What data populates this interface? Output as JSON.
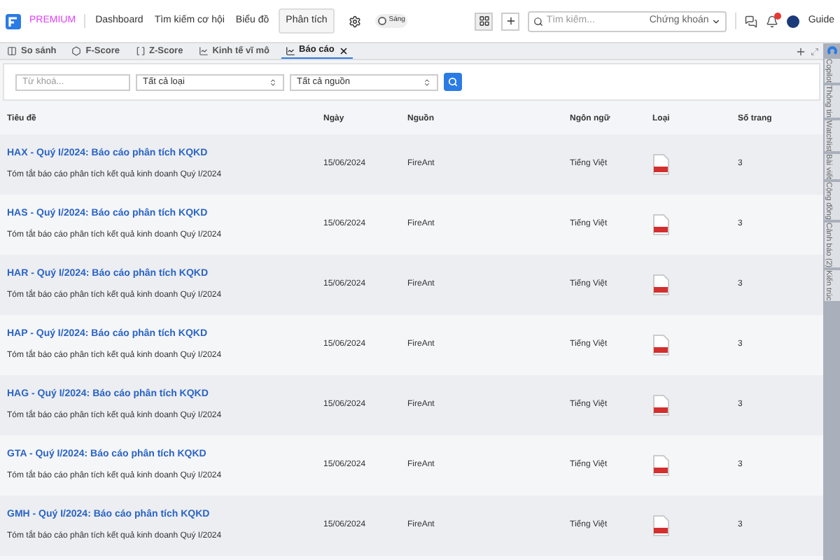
{
  "top_bar": {
    "brand": "PREMIUM",
    "nav": [
      {
        "label": "Dashboard",
        "selected": false
      },
      {
        "label": "Tìm kiếm cơ hội",
        "selected": false
      },
      {
        "label": "Biểu đồ",
        "selected": false
      },
      {
        "label": "Phân tích",
        "selected": true
      }
    ],
    "theme_toggle": {
      "label": "Sáng",
      "on": false
    },
    "search": {
      "placeholder": "Tìm kiếm...",
      "scope": "Chứng khoán"
    },
    "user": "Guide"
  },
  "tabs": [
    {
      "label": "So sánh",
      "selected": false,
      "closable": false
    },
    {
      "label": "F-Score",
      "selected": false,
      "closable": false
    },
    {
      "label": "Z-Score",
      "selected": false,
      "closable": false
    },
    {
      "label": "Kinh tế vĩ mô",
      "selected": false,
      "closable": false
    },
    {
      "label": "Báo cáo",
      "selected": true,
      "closable": true
    }
  ],
  "filters": {
    "keyword": {
      "placeholder": "Từ khoá..."
    },
    "type": "Tất cả loại",
    "source": "Tất cả nguồn"
  },
  "table": {
    "columns": [
      "Tiêu đề",
      "Ngày",
      "Nguồn",
      "Ngôn ngữ",
      "Loại",
      "Số trang"
    ],
    "rows": [
      {
        "title": "HAX - Quý I/2024: Báo cáo phân tích KQKD",
        "summary": "Tóm tắt báo cáo phân tích kết quả kinh doanh Quý I/2024",
        "date": "15/06/2024",
        "source": "FireAnt",
        "language": "Tiếng Việt",
        "kind": "pdf",
        "pages": "3"
      },
      {
        "title": "HAS - Quý I/2024: Báo cáo phân tích KQKD",
        "summary": "Tóm tắt báo cáo phân tích kết quả kinh doanh Quý I/2024",
        "date": "15/06/2024",
        "source": "FireAnt",
        "language": "Tiếng Việt",
        "kind": "pdf",
        "pages": "3"
      },
      {
        "title": "HAR - Quý I/2024: Báo cáo phân tích KQKD",
        "summary": "Tóm tắt báo cáo phân tích kết quả kinh doanh Quý I/2024",
        "date": "15/06/2024",
        "source": "FireAnt",
        "language": "Tiếng Việt",
        "kind": "pdf",
        "pages": "3"
      },
      {
        "title": "HAP - Quý I/2024: Báo cáo phân tích KQKD",
        "summary": "Tóm tắt báo cáo phân tích kết quả kinh doanh Quý I/2024",
        "date": "15/06/2024",
        "source": "FireAnt",
        "language": "Tiếng Việt",
        "kind": "pdf",
        "pages": "3"
      },
      {
        "title": "HAG - Quý I/2024: Báo cáo phân tích KQKD",
        "summary": "Tóm tắt báo cáo phân tích kết quả kinh doanh Quý I/2024",
        "date": "15/06/2024",
        "source": "FireAnt",
        "language": "Tiếng Việt",
        "kind": "pdf",
        "pages": "3"
      },
      {
        "title": "GTA - Quý I/2024: Báo cáo phân tích KQKD",
        "summary": "Tóm tắt báo cáo phân tích kết quả kinh doanh Quý I/2024",
        "date": "15/06/2024",
        "source": "FireAnt",
        "language": "Tiếng Việt",
        "kind": "pdf",
        "pages": "3"
      },
      {
        "title": "GMH - Quý I/2024: Báo cáo phân tích KQKD",
        "summary": "Tóm tắt báo cáo phân tích kết quả kinh doanh Quý I/2024",
        "date": "15/06/2024",
        "source": "FireAnt",
        "language": "Tiếng Việt",
        "kind": "pdf",
        "pages": "3"
      }
    ]
  },
  "side_tabs": [
    "Copilot",
    "Thông tin",
    "Watchlist",
    "Bài viết",
    "Cộng đồng",
    "Cảnh báo (2)",
    "Kiến trúc"
  ]
}
